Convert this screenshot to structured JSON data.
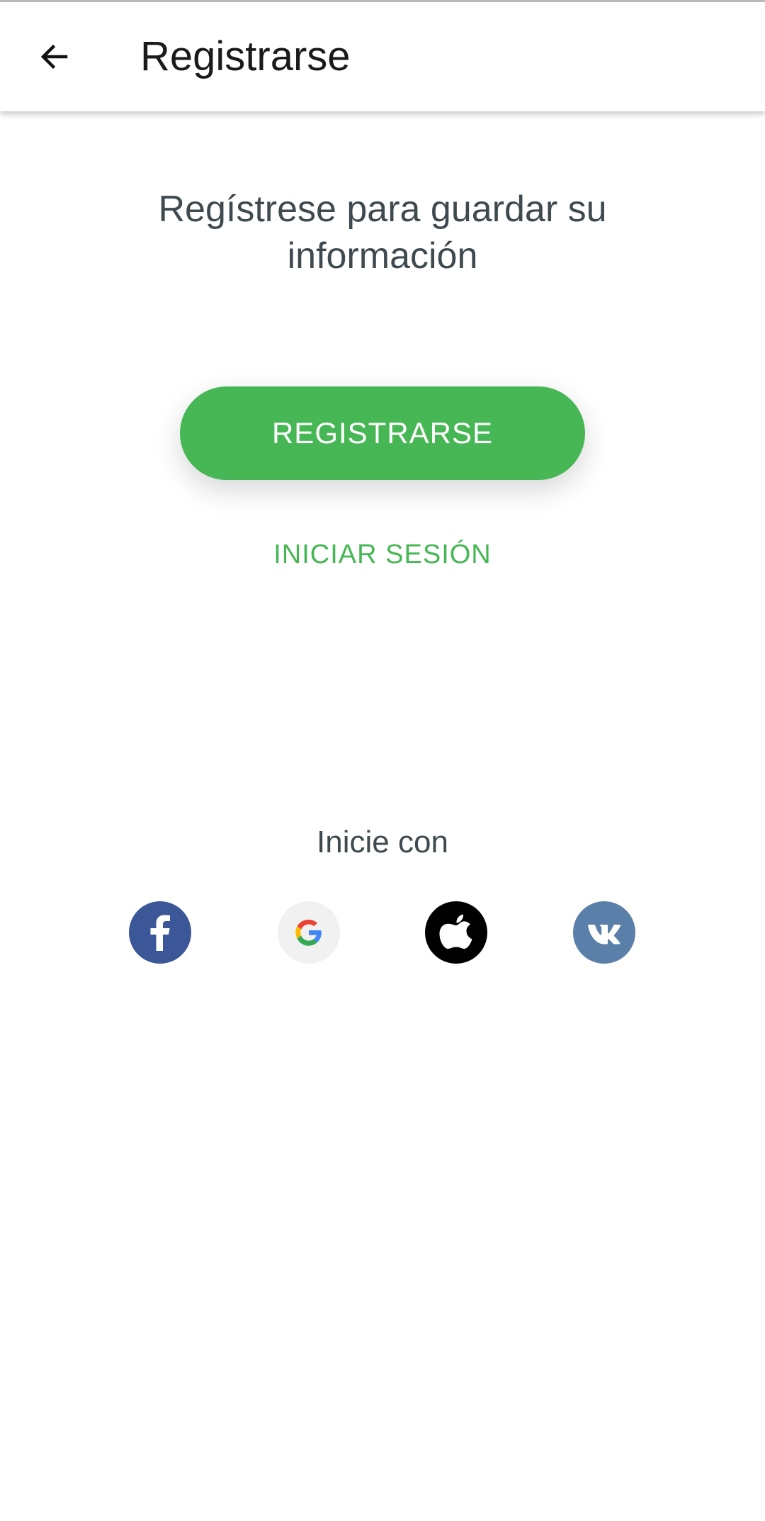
{
  "appbar": {
    "title": "Registrarse",
    "back_icon": "arrow-left-icon"
  },
  "main": {
    "headline": "Regístrese para guardar su información",
    "register_button": "REGISTRARSE",
    "login_link": "INICIAR SESIÓN",
    "login_with_label": "Inicie con"
  },
  "social": [
    {
      "name": "facebook",
      "icon": "facebook-icon",
      "color": "#3b5798"
    },
    {
      "name": "google",
      "icon": "google-icon",
      "color": "#f1f1f1"
    },
    {
      "name": "apple",
      "icon": "apple-icon",
      "color": "#000000"
    },
    {
      "name": "vk",
      "icon": "vk-icon",
      "color": "#5a7fa8"
    }
  ],
  "colors": {
    "accent": "#46b754",
    "text": "#3f4a4f",
    "title": "#1a1a1a"
  }
}
